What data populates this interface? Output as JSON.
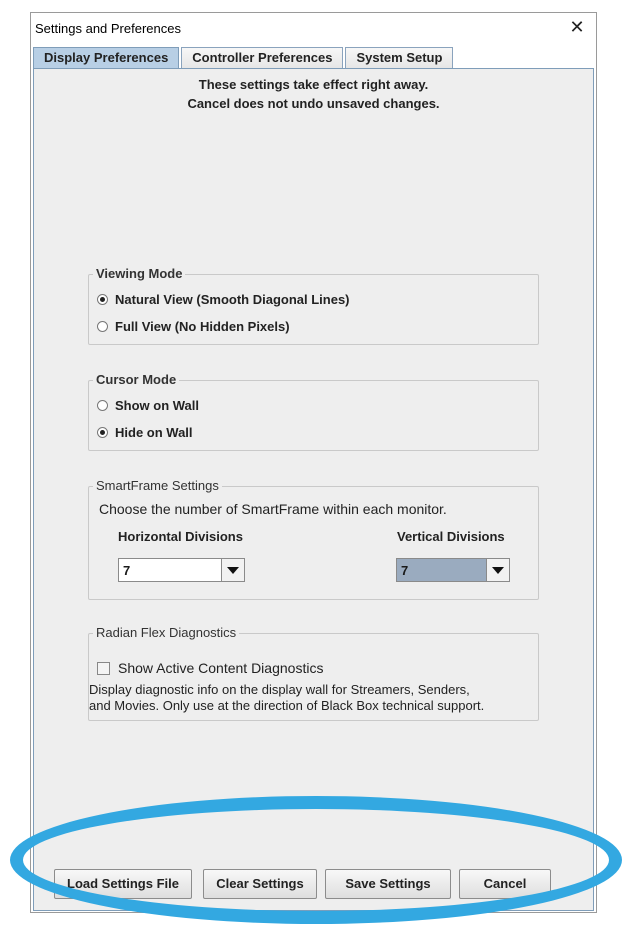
{
  "window": {
    "title": "Settings and Preferences",
    "close_glyph": "✕"
  },
  "tabs": [
    {
      "label": "Display Preferences",
      "active": true
    },
    {
      "label": "Controller Preferences",
      "active": false
    },
    {
      "label": "System Setup",
      "active": false
    }
  ],
  "notice": {
    "line1": "These settings take effect right away.",
    "line2": "Cancel does not undo unsaved changes."
  },
  "viewing_mode": {
    "legend": "Viewing Mode",
    "options": [
      {
        "label": "Natural View (Smooth Diagonal Lines)",
        "selected": true
      },
      {
        "label": "Full View (No Hidden Pixels)",
        "selected": false
      }
    ]
  },
  "cursor_mode": {
    "legend": "Cursor Mode",
    "options": [
      {
        "label": "Show on Wall",
        "selected": false
      },
      {
        "label": "Hide on Wall",
        "selected": true
      }
    ]
  },
  "smartframe": {
    "legend": "SmartFrame Settings",
    "description": "Choose the number of SmartFrame within each monitor.",
    "horizontal_label": "Horizontal Divisions",
    "vertical_label": "Vertical Divisions",
    "horizontal_value": "7",
    "vertical_value": "7"
  },
  "diagnostics": {
    "legend": "Radian Flex Diagnostics",
    "checkbox_label": "Show Active Content Diagnostics",
    "checked": false,
    "description_line1": "Display diagnostic info on the display wall for Streamers, Senders,",
    "description_line2": "and Movies. Only use at the direction of Black Box technical support."
  },
  "buttons": {
    "load": "Load Settings File",
    "clear": "Clear Settings",
    "save": "Save Settings",
    "cancel": "Cancel"
  },
  "colors": {
    "highlight_ellipse": "#33a8e1",
    "active_tab": "#b8cfe5",
    "disabled_combo": "#9aabbf"
  }
}
